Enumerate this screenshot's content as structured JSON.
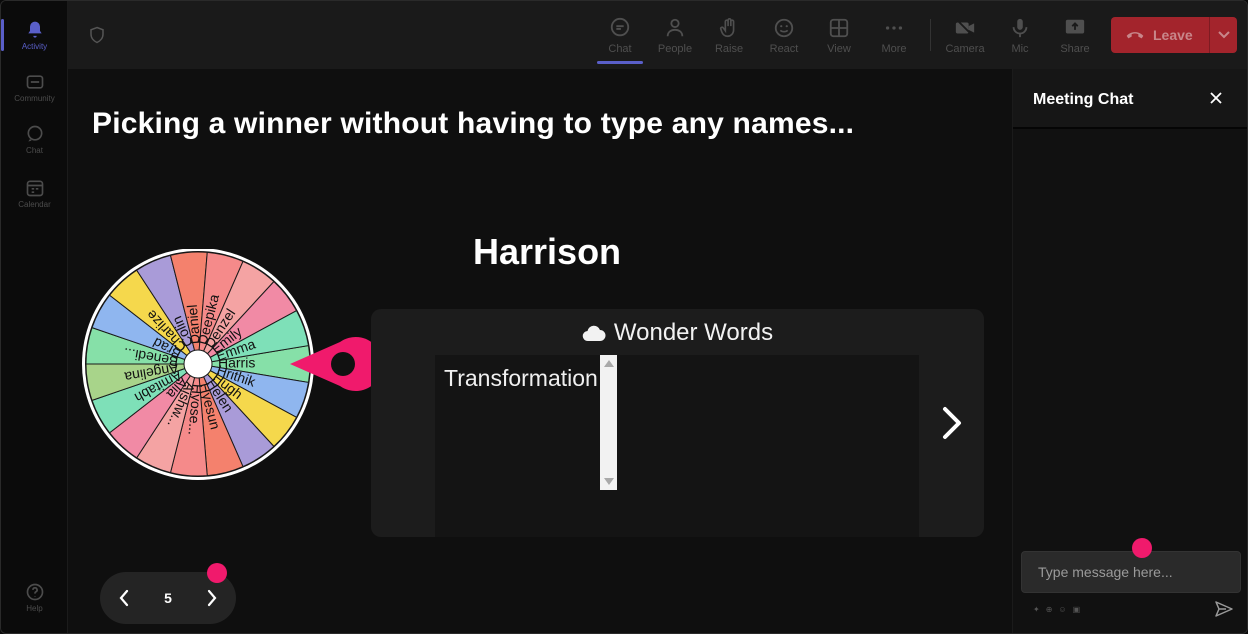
{
  "rail": {
    "items": [
      {
        "label": "Activity",
        "icon": "bell-icon"
      },
      {
        "label": "Community",
        "icon": "community-icon"
      },
      {
        "label": "Chat",
        "icon": "chat-icon"
      },
      {
        "label": "Calendar",
        "icon": "calendar-icon"
      },
      {
        "label": "Help",
        "icon": "help-icon"
      }
    ]
  },
  "toolbar": {
    "chat": "Chat",
    "people": "People",
    "raise": "Raise",
    "react": "React",
    "view": "View",
    "more": "More",
    "camera": "Camera",
    "mic": "Mic",
    "share": "Share",
    "leave": "Leave"
  },
  "stage": {
    "headline": "Picking a winner without having to type any names...",
    "winner": "Harrison",
    "wheel_names": [
      "Harris",
      "Hrithik",
      "Hugh",
      "Helen",
      "Hyesun",
      "Hyose...",
      "Aishw...",
      "Alia",
      "Amitabh",
      "Angelina",
      "Benedi...",
      "Brad",
      "Charlize",
      "Colin",
      "Daniel",
      "Deepika",
      "Denzel",
      "Emily",
      "Emma"
    ],
    "card_title": "Wonder Words",
    "word": "Transformation",
    "page_number": "5"
  },
  "chat": {
    "title": "Meeting Chat",
    "placeholder": "Type message here..."
  },
  "colors": {
    "accent": "#5a5fc9",
    "leave": "#a3242c",
    "pink": "#f01a6c",
    "wheel": [
      "#86e0a8",
      "#8fb6ef",
      "#f5d84c",
      "#a99bd8",
      "#f4816d",
      "#f58a8a",
      "#f4a3a3",
      "#f18aa5",
      "#7ee0b8",
      "#a8d48a"
    ]
  }
}
